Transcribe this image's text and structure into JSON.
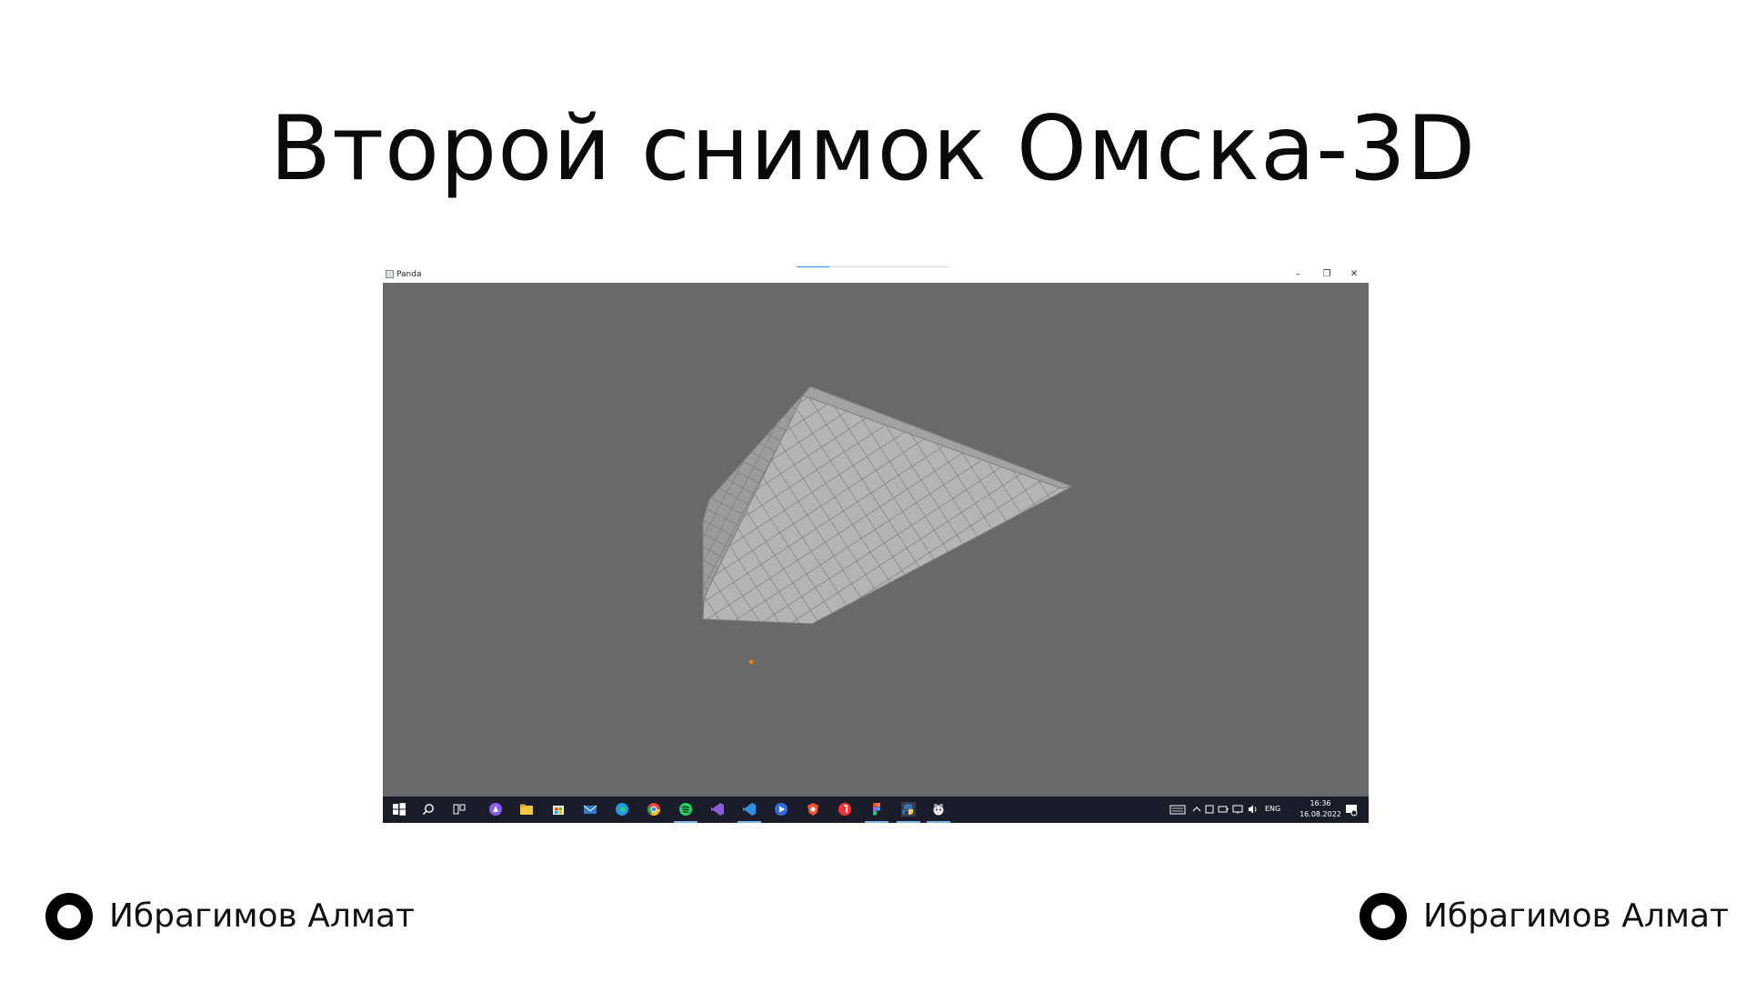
{
  "slide": {
    "title": "Второй снимок Омска-3D",
    "footer_left": "Ибрагимов Алмат",
    "footer_right": "Ибрагимов Алмат"
  },
  "window": {
    "title": "Panda",
    "minimize_glyph": "–",
    "restore_glyph": "❐",
    "close_glyph": "✕",
    "viewport_color": "#696969",
    "model_color": "#a9a9a9",
    "marker_color": "#f07a1a"
  },
  "taskbar": {
    "background": "#1b1c2a",
    "language": "ENG",
    "time": "16:36",
    "date": "16.08.2022",
    "apps": [
      "start-icon",
      "search-icon",
      "task-view-icon",
      "alice-icon",
      "file-explorer-icon",
      "store-icon",
      "mail-icon",
      "edge-icon",
      "chrome-icon",
      "spotify-icon",
      "visual-studio-icon",
      "vscode-icon",
      "media-player-icon",
      "brave-icon",
      "yandex-browser-icon",
      "figma-icon",
      "python-icon",
      "panda-icon"
    ]
  }
}
